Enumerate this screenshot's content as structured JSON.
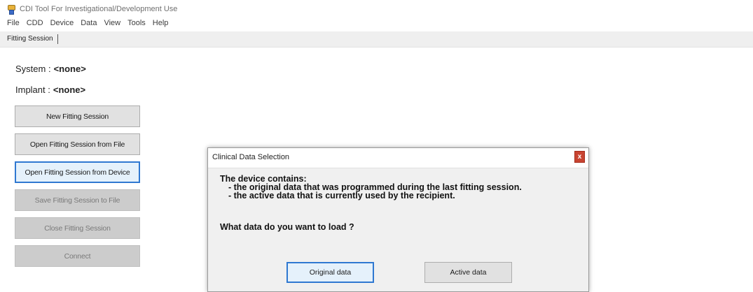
{
  "window": {
    "title": "CDI Tool For Investigational/Development Use"
  },
  "menu": [
    "File",
    "CDD",
    "Device",
    "Data",
    "View",
    "Tools",
    "Help"
  ],
  "tabs": [
    {
      "label": "Fitting Session"
    }
  ],
  "info": {
    "system_label": "System :",
    "system_value": "<none>",
    "implant_label": "Implant :",
    "implant_value": "<none>"
  },
  "buttons": [
    {
      "label": "New Fitting Session",
      "state": "enabled"
    },
    {
      "label": "Open Fitting Session from File",
      "state": "enabled"
    },
    {
      "label": "Open Fitting Session from Device",
      "state": "focused"
    },
    {
      "label": "Save Fitting Session to File",
      "state": "disabled"
    },
    {
      "label": "Close Fitting Session",
      "state": "disabled"
    },
    {
      "label": "Connect",
      "state": "disabled"
    }
  ],
  "dialog": {
    "title": "Clinical Data Selection",
    "close_glyph": "x",
    "heading": "The device contains:",
    "bullet_1": "- the original data that was programmed during the last fitting session.",
    "bullet_2": "- the active data that is currently used by the recipient.",
    "question": "What data do you want to load ?",
    "original_button": "Original data",
    "active_button": "Active data"
  },
  "icons": {
    "app": "app-icon",
    "close": "close-icon"
  },
  "colors": {
    "focus_blue": "#2f78d1",
    "close_red": "#c84431",
    "disabled_gray": "#cccccc",
    "button_gray": "#e1e1e1"
  }
}
